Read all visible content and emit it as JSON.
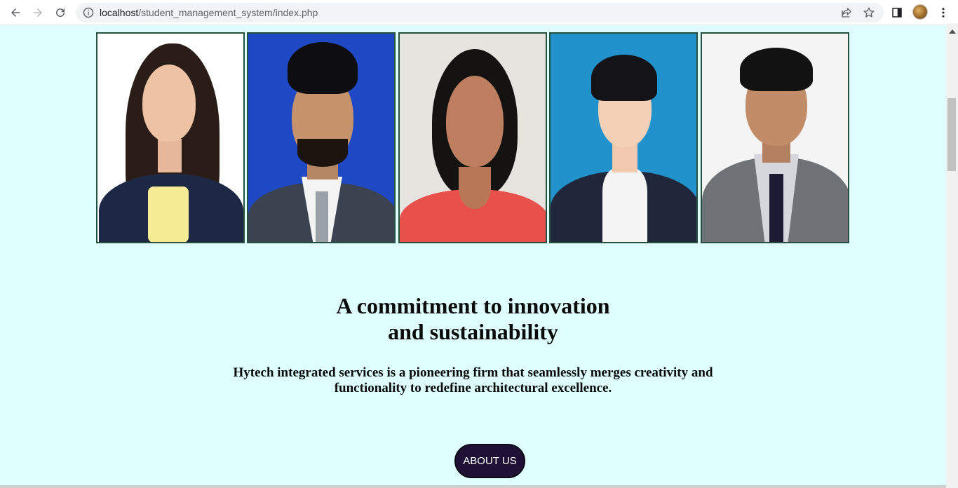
{
  "browser": {
    "url_host": "localhost",
    "url_path": "/student_management_system/index.php",
    "icons": [
      "back-icon",
      "forward-icon",
      "reload-icon",
      "info-icon",
      "share-icon",
      "star-icon",
      "side-panel-icon",
      "profile-avatar",
      "menu-dots-icon"
    ]
  },
  "gallery": {
    "photos": [
      {
        "subject": "woman-long-dark-hair",
        "bg": "#ffffff"
      },
      {
        "subject": "man-beard-suit",
        "bg": "#1f48c4"
      },
      {
        "subject": "woman-short-hair-coral-top",
        "bg": "#e7e3df"
      },
      {
        "subject": "woman-updo-blazer",
        "bg": "#2192cc"
      },
      {
        "subject": "man-grey-suit",
        "bg": "#f4f4f4"
      }
    ]
  },
  "hero": {
    "headline_line1": "A commitment to innovation",
    "headline_line2": "and sustainability",
    "lead_line1": "Hytech integrated services is a pioneering firm that seamlessly merges creativity and",
    "lead_line2": "functionality to redefine architectural excellence.",
    "button_label": "ABOUT US"
  },
  "colors": {
    "page_bg": "#dfffff",
    "button_bg": "#1f1136"
  }
}
